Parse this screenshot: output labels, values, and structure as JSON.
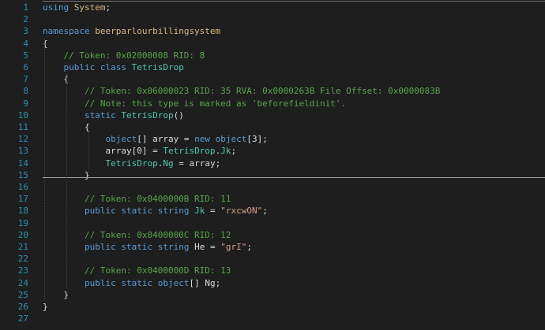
{
  "editor": {
    "line_numbers": [
      "1",
      "2",
      "3",
      "4",
      "5",
      "6",
      "7",
      "8",
      "9",
      "10",
      "11",
      "12",
      "13",
      "14",
      "15",
      "16",
      "17",
      "18",
      "19",
      "20",
      "21",
      "22",
      "23",
      "24",
      "25",
      "26",
      "27"
    ],
    "lines": [
      [
        {
          "t": "using",
          "c": "kw"
        },
        {
          "t": " ",
          "c": "pl"
        },
        {
          "t": "System",
          "c": "hl"
        },
        {
          "t": ";",
          "c": "pl"
        }
      ],
      [],
      [
        {
          "t": "namespace",
          "c": "kw"
        },
        {
          "t": " beerparlourbillingsystem",
          "c": "hl"
        }
      ],
      [
        {
          "t": "{",
          "c": "pl"
        }
      ],
      [
        {
          "t": "    // Token: 0x02000008 RID: 8",
          "c": "cm"
        }
      ],
      [
        {
          "t": "    ",
          "c": "pl"
        },
        {
          "t": "public",
          "c": "kw"
        },
        {
          "t": " ",
          "c": "pl"
        },
        {
          "t": "class",
          "c": "kw"
        },
        {
          "t": " ",
          "c": "pl"
        },
        {
          "t": "TetrisDrop",
          "c": "ty"
        }
      ],
      [
        {
          "t": "    {",
          "c": "pl"
        }
      ],
      [
        {
          "t": "        // Token: 0x06000023 RID: 35 RVA: 0x0000263B File Offset: 0x0000083B",
          "c": "cm"
        }
      ],
      [
        {
          "t": "        // Note: this type is marked as 'beforefieldinit'.",
          "c": "cm"
        }
      ],
      [
        {
          "t": "        ",
          "c": "pl"
        },
        {
          "t": "static",
          "c": "kw"
        },
        {
          "t": " ",
          "c": "pl"
        },
        {
          "t": "TetrisDrop",
          "c": "ty"
        },
        {
          "t": "()",
          "c": "pl"
        }
      ],
      [
        {
          "t": "        {",
          "c": "pl"
        }
      ],
      [
        {
          "t": "            ",
          "c": "pl"
        },
        {
          "t": "object",
          "c": "kw"
        },
        {
          "t": "[] array = ",
          "c": "pl"
        },
        {
          "t": "new",
          "c": "kw"
        },
        {
          "t": " ",
          "c": "pl"
        },
        {
          "t": "object",
          "c": "kw"
        },
        {
          "t": "[3];",
          "c": "pl"
        }
      ],
      [
        {
          "t": "            array[0] = ",
          "c": "pl"
        },
        {
          "t": "TetrisDrop",
          "c": "ty"
        },
        {
          "t": ".",
          "c": "pl"
        },
        {
          "t": "Jk",
          "c": "ty"
        },
        {
          "t": ";",
          "c": "pl"
        }
      ],
      [
        {
          "t": "            ",
          "c": "pl"
        },
        {
          "t": "TetrisDrop",
          "c": "ty"
        },
        {
          "t": ".",
          "c": "pl"
        },
        {
          "t": "Ng",
          "c": "ty"
        },
        {
          "t": " = array;",
          "c": "pl"
        }
      ],
      [
        {
          "t": "        }",
          "c": "pl"
        }
      ],
      [],
      [
        {
          "t": "        // Token: 0x0400000B RID: 11",
          "c": "cm"
        }
      ],
      [
        {
          "t": "        ",
          "c": "pl"
        },
        {
          "t": "public",
          "c": "kw"
        },
        {
          "t": " ",
          "c": "pl"
        },
        {
          "t": "static",
          "c": "kw"
        },
        {
          "t": " ",
          "c": "pl"
        },
        {
          "t": "string",
          "c": "kw"
        },
        {
          "t": " ",
          "c": "pl"
        },
        {
          "t": "Jk",
          "c": "ty"
        },
        {
          "t": " = ",
          "c": "pl"
        },
        {
          "t": "\"rxcwON\"",
          "c": "st"
        },
        {
          "t": ";",
          "c": "pl"
        }
      ],
      [],
      [
        {
          "t": "        // Token: 0x0400000C RID: 12",
          "c": "cm"
        }
      ],
      [
        {
          "t": "        ",
          "c": "pl"
        },
        {
          "t": "public",
          "c": "kw"
        },
        {
          "t": " ",
          "c": "pl"
        },
        {
          "t": "static",
          "c": "kw"
        },
        {
          "t": " ",
          "c": "pl"
        },
        {
          "t": "string",
          "c": "kw"
        },
        {
          "t": " He = ",
          "c": "pl"
        },
        {
          "t": "\"grI\"",
          "c": "st"
        },
        {
          "t": ";",
          "c": "pl"
        }
      ],
      [],
      [
        {
          "t": "        // Token: 0x0400000D RID: 13",
          "c": "cm"
        }
      ],
      [
        {
          "t": "        ",
          "c": "pl"
        },
        {
          "t": "public",
          "c": "kw"
        },
        {
          "t": " ",
          "c": "pl"
        },
        {
          "t": "static",
          "c": "kw"
        },
        {
          "t": " ",
          "c": "pl"
        },
        {
          "t": "object",
          "c": "kw"
        },
        {
          "t": "[] Ng;",
          "c": "pl"
        }
      ],
      [
        {
          "t": "    }",
          "c": "pl"
        }
      ],
      [
        {
          "t": "}",
          "c": "pl"
        }
      ],
      []
    ]
  }
}
